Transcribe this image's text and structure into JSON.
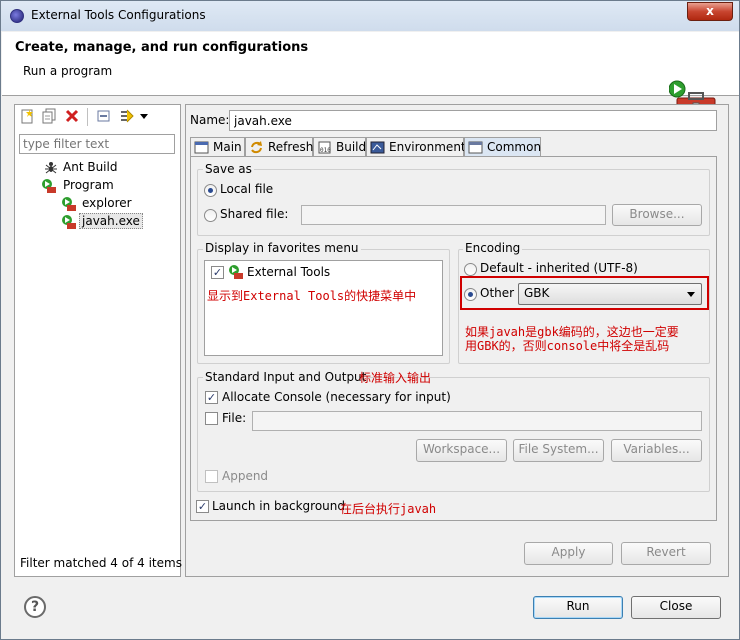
{
  "window": {
    "title": "External Tools Configurations",
    "close": "x"
  },
  "header": {
    "title": "Create, manage, and run configurations",
    "subtitle": "Run a program"
  },
  "left": {
    "filter_placeholder": "type filter text",
    "tree": [
      {
        "label": "Ant Build",
        "icon": "ant-icon"
      },
      {
        "label": "Program",
        "icon": "program-icon"
      },
      {
        "label": "explorer",
        "icon": "program-icon"
      },
      {
        "label": "javah.exe",
        "icon": "program-icon",
        "selected": true
      }
    ],
    "status": "Filter matched 4 of 4 items"
  },
  "form": {
    "name_label": "Name:",
    "name_value": "javah.exe",
    "tabs": [
      "Main",
      "Refresh",
      "Build",
      "Environment",
      "Common"
    ],
    "active_tab": "Common",
    "save_as": {
      "label": "Save as",
      "local": "Local file",
      "shared": "Shared file:",
      "browse": "Browse..."
    },
    "favorites": {
      "label": "Display in favorites menu",
      "item": "External Tools",
      "annotation": "显示到External Tools的快捷菜单中"
    },
    "encoding": {
      "label": "Encoding",
      "default": "Default - inherited (UTF-8)",
      "other": "Other",
      "other_value": "GBK",
      "annotation_line1": "如果javah是gbk编码的，这边也一定要",
      "annotation_line2": "用GBK的，否则console中将全是乱码"
    },
    "std_io": {
      "label": "Standard Input and Output",
      "annotation": "标准输入输出",
      "allocate": "Allocate Console (necessary for input)",
      "file": "File:",
      "workspace": "Workspace...",
      "file_system": "File System...",
      "variables": "Variables...",
      "append": "Append"
    },
    "launch_bg": "Launch in background",
    "launch_bg_annotation": "在后台执行javah",
    "apply": "Apply",
    "revert": "Revert"
  },
  "footer": {
    "help": "?",
    "run": "Run",
    "close": "Close"
  },
  "colors": {
    "annotation": "#d00000",
    "tab_active": "#dbe6f3"
  }
}
